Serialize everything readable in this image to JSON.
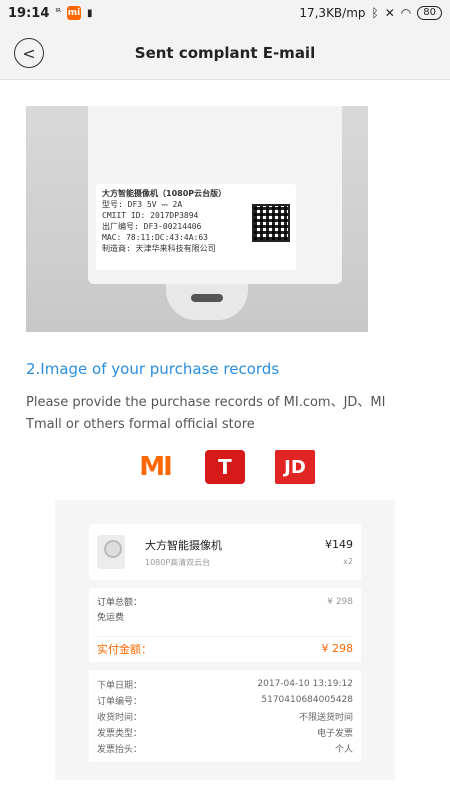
{
  "status": {
    "time": "19:14",
    "left_icon_1": "ᴵᴿ",
    "mi_icon_text": "mi",
    "left_icon_3": "▮",
    "network_speed": "17,3KB/mp",
    "battery": "80"
  },
  "header": {
    "back_icon": "<",
    "title": "Sent complant E-mail"
  },
  "device_label": {
    "line1": "大方智能摄像机（1080P云台版）",
    "line2": "型号: DF3   5V ⎓ 2A",
    "line3": "CMIIT ID: 2017DP3894",
    "line4": "出厂编号: DF3-00214406",
    "line5": "MAC: 78:11:DC:43:4A:63",
    "line6": "制造商: 天津华来科技有限公司"
  },
  "section": {
    "heading": "2.Image of your purchase records",
    "description": "Please provide the purchase records of MI.com、JD、MI Tmall or others formal official store"
  },
  "logos": {
    "mi": "MI",
    "tmall": "T",
    "jd": "JD"
  },
  "order": {
    "product_name": "大方智能摄像机",
    "product_sub": "1080P高清双云台",
    "price": "¥149",
    "qty": "x2",
    "total_label": "订单总额：",
    "total_value": "¥ 298",
    "shipping_label": "免运费",
    "paid_label": "实付金额：",
    "paid_value": "¥ 298",
    "details": [
      {
        "label": "下单日期：",
        "value": "2017-04-10 13:19:12"
      },
      {
        "label": "订单编号：",
        "value": "5170410684005428"
      },
      {
        "label": "收货时间：",
        "value": "不限送货时间"
      },
      {
        "label": "发票类型：",
        "value": "电子发票"
      },
      {
        "label": "发票抬头：",
        "value": "个人"
      }
    ]
  },
  "colors": {
    "accent_blue": "#2b8ee0",
    "mi_orange": "#ff6700",
    "jd_red": "#e12424"
  }
}
